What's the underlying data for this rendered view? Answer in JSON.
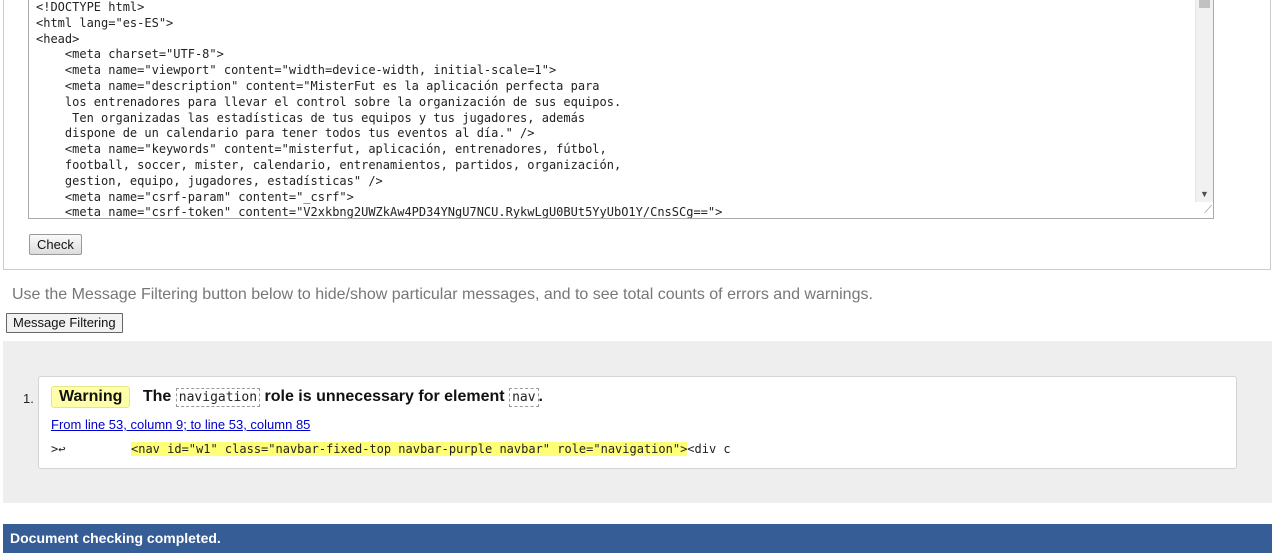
{
  "source": {
    "lines": [
      "<!DOCTYPE html>",
      "<html lang=\"es-ES\">",
      "<head>",
      "    <meta charset=\"UTF-8\">",
      "    <meta name=\"viewport\" content=\"width=device-width, initial-scale=1\">",
      "    <meta name=\"description\" content=\"MisterFut es la aplicación perfecta para",
      "    los entrenadores para llevar el control sobre la organización de sus equipos.",
      "     Ten organizadas las estadísticas de tus equipos y tus jugadores, además",
      "    dispone de un calendario para tener todos tus eventos al día.\" />",
      "    <meta name=\"keywords\" content=\"misterfut, aplicación, entrenadores, fútbol,",
      "    football, soccer, mister, calendario, entrenamientos, partidos, organización,",
      "    gestion, equipo, jugadores, estadísticas\" />",
      "    <meta name=\"csrf-param\" content=\"_csrf\">",
      "    <meta name=\"csrf-token\" content=\"V2xkbng2UWZkAw4PD34YNgU7NCU.RykwLgU0BUt5YyUbO1Y/CnsSCg==\">"
    ],
    "scroll_down_icon": "triangle-down",
    "resize_icon": "resize-grip"
  },
  "form": {
    "check_label": "Check"
  },
  "filtering": {
    "intro": "Use the Message Filtering button below to hide/show particular messages, and to see total counts of errors and warnings.",
    "button_label": "Message Filtering"
  },
  "messages": [
    {
      "number": "1.",
      "type": "Warning",
      "text_before": "The",
      "code1": "navigation",
      "text_middle": "role is unnecessary for element",
      "code2": "nav",
      "text_after": ".",
      "location": "From line 53, column 9; to line 53, column 85",
      "extract_prefix": ">↩",
      "extract_highlight": "<nav id=\"w1\" class=\"navbar-fixed-top navbar-purple navbar\" role=\"navigation\">",
      "extract_suffix": "<div c"
    }
  ],
  "status": {
    "text": "Document checking completed."
  },
  "colors": {
    "status_bar": "#365d95",
    "warning_badge": "#ffffaa",
    "highlight": "#ffff77"
  }
}
